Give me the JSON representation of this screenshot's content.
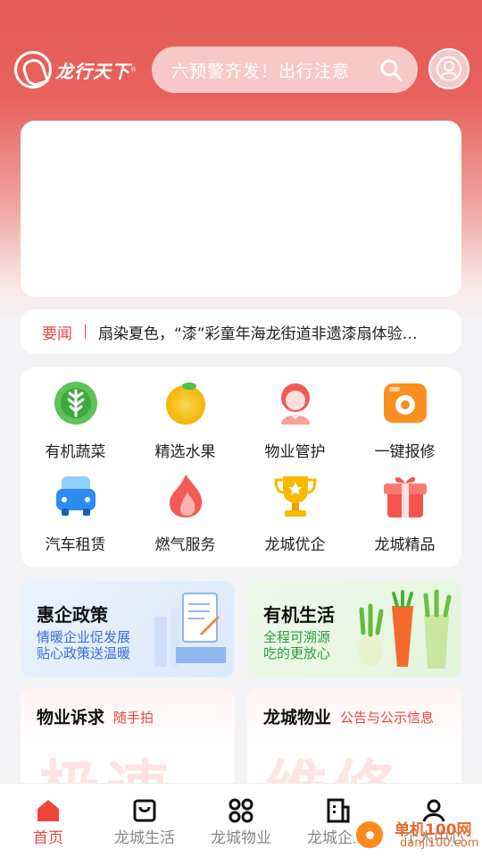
{
  "colors": {
    "brand": "#e45a54",
    "accent_red": "#e7473f",
    "blue": "#3a6fd8",
    "green": "#2e9e3e"
  },
  "header": {
    "logo_text": "龙行天下",
    "logo_reg": "®",
    "search_placeholder": "六预警齐发！出行注意",
    "search_icon": "search-icon",
    "avatar_icon": "user-icon"
  },
  "news": {
    "tag": "要闻",
    "headline": "扇染夏色，“漆”彩童年海龙街道非遗漆扇体验活动"
  },
  "services": [
    {
      "label": "有机蔬菜",
      "icon": "leaf-icon"
    },
    {
      "label": "精选水果",
      "icon": "orange-icon"
    },
    {
      "label": "物业管护",
      "icon": "staff-icon"
    },
    {
      "label": "一键报修",
      "icon": "camera-icon"
    },
    {
      "label": "汽车租赁",
      "icon": "car-icon"
    },
    {
      "label": "燃气服务",
      "icon": "flame-icon"
    },
    {
      "label": "龙城优企",
      "icon": "trophy-icon"
    },
    {
      "label": "龙城精品",
      "icon": "gift-icon"
    }
  ],
  "promos": {
    "left": {
      "title": "惠企政策",
      "line1": "情暖企业促发展",
      "line2": "贴心政策送温暖"
    },
    "right": {
      "title": "有机生活",
      "line1": "全程可溯源",
      "line2": "吃的更放心"
    }
  },
  "cards": {
    "left": {
      "title": "物业诉求",
      "sub": "随手拍",
      "big": "极速"
    },
    "right": {
      "title": "龙城物业",
      "sub": "公告与公示信息",
      "big": "维修"
    }
  },
  "tabs": [
    {
      "label": "首页",
      "icon": "home-icon",
      "active": true
    },
    {
      "label": "龙城生活",
      "icon": "bag-icon",
      "active": false
    },
    {
      "label": "龙城物业",
      "icon": "grid-icon",
      "active": false
    },
    {
      "label": "龙城企业",
      "icon": "building-icon",
      "active": false
    },
    {
      "label": "个人中心",
      "icon": "profile-icon",
      "active": false
    }
  ],
  "watermark": {
    "line1": "单机100网",
    "line2": "danji100.com"
  }
}
